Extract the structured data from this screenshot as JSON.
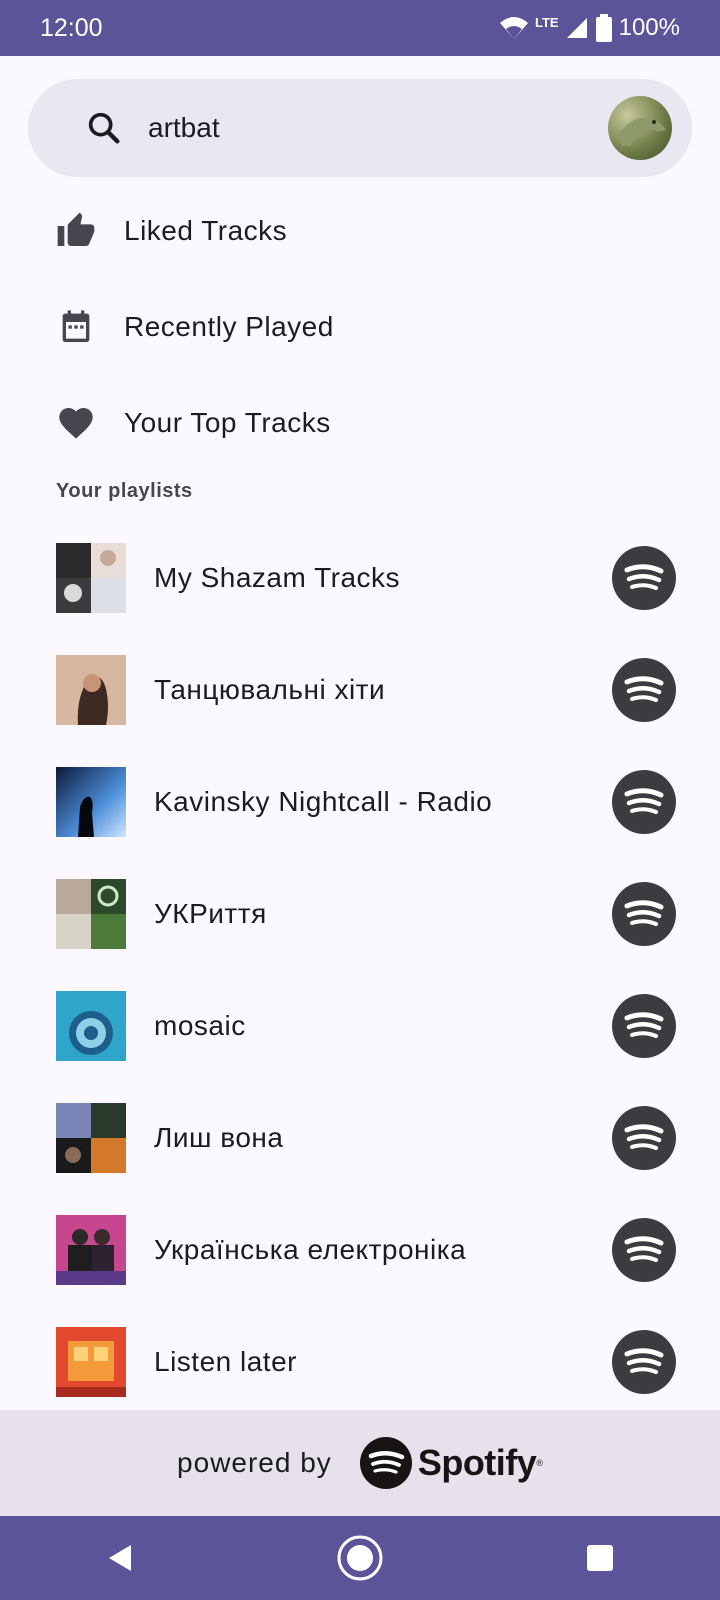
{
  "status_bar": {
    "time": "12:00",
    "network_label": "LTE",
    "battery_text": "100%"
  },
  "search": {
    "value": "artbat",
    "placeholder": "Search",
    "icon": "search-icon"
  },
  "menu": [
    {
      "label": "Liked Tracks",
      "icon": "thumb-up-icon"
    },
    {
      "label": "Recently Played",
      "icon": "calendar-icon"
    },
    {
      "label": "Your Top Tracks",
      "icon": "heart-icon"
    }
  ],
  "playlists_section": {
    "title": "Your playlists"
  },
  "playlists": [
    {
      "name": "My Shazam Tracks"
    },
    {
      "name": "Танцювальні хіти"
    },
    {
      "name": "Kavinsky Nightcall - Radio"
    },
    {
      "name": "УКРиття"
    },
    {
      "name": "mosaic"
    },
    {
      "name": "Лиш вона"
    },
    {
      "name": "Українська електроніка"
    },
    {
      "name": "Listen later"
    }
  ],
  "footer": {
    "powered_text": "powered by",
    "brand": "Spotify"
  },
  "colors": {
    "accent": "#5c5498",
    "background": "#fcf8ff",
    "search_bg": "#e9e7f2",
    "spotify_button": "#3c3b40"
  }
}
